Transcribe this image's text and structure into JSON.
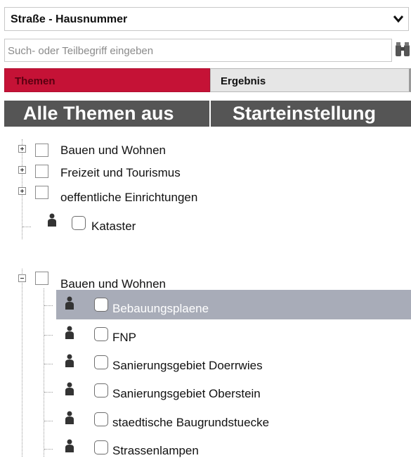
{
  "search_select": {
    "selected": "Straße - Hausnummer",
    "chevron_icon": "chevron-down-icon"
  },
  "search": {
    "placeholder": "Such- oder Teilbegriff eingeben",
    "icon": "binoculars-icon"
  },
  "tabs": [
    {
      "label": "Themen",
      "active": true
    },
    {
      "label": "Ergebnis",
      "active": false
    }
  ],
  "buttons": {
    "all_off": "Alle Themen aus",
    "default": "Starteinstellung"
  },
  "colors": {
    "active_tab": "#c51236",
    "button_bg": "#555555",
    "selection": "#a8acb8"
  },
  "tree": {
    "groups": [
      {
        "label": "Bauen und Wohnen",
        "expanded": false
      },
      {
        "label": "Freizeit und Tourismus",
        "expanded": false
      },
      {
        "label": "oeffentliche Einrichtungen",
        "expanded": false
      }
    ],
    "standalone": [
      {
        "label": "Kataster"
      }
    ],
    "expanded_group": {
      "label": "Bauen und Wohnen",
      "expanded": true,
      "children": [
        {
          "label": "Bebauungsplaene",
          "selected": true
        },
        {
          "label": "FNP"
        },
        {
          "label": "Sanierungsgebiet Doerrwies"
        },
        {
          "label": "Sanierungsgebiet Oberstein"
        },
        {
          "label": "staedtische Baugrundstuecke"
        },
        {
          "label": "Strassenlampen"
        }
      ]
    }
  }
}
